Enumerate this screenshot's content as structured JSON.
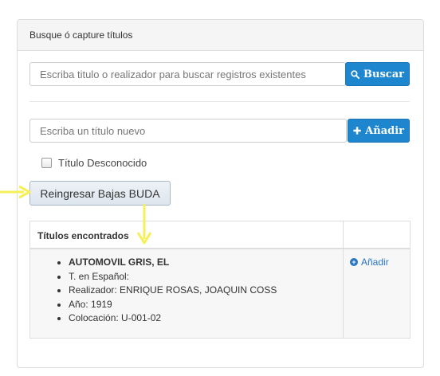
{
  "panel": {
    "heading": "Busque ó capture títulos"
  },
  "search": {
    "placeholder": "Escriba titulo o realizador para buscar registros existentes",
    "button_label": "Buscar",
    "button_icon": "search-icon"
  },
  "new_title": {
    "placeholder": "Escriba un título nuevo",
    "button_label": "Añadir",
    "button_icon": "plus-icon"
  },
  "unknown_title": {
    "label": "Título Desconocido",
    "checked": false
  },
  "reingresar_button": {
    "label": "Reingresar Bajas BUDA"
  },
  "results": {
    "header": "Títulos encontrados",
    "items": [
      {
        "name": "AUTOMOVIL GRIS, EL",
        "spanish_title": "T. en Español:",
        "director": "Realizador: ENRIQUE ROSAS, JOAQUIN COSS",
        "year": "Año: 1919",
        "location": "Colocación: U-001-02",
        "action_label": "Añadir"
      }
    ]
  },
  "colors": {
    "primary_button": "#1e86cf",
    "link": "#2a75c0",
    "annotation_arrow": "#f5ef58"
  }
}
